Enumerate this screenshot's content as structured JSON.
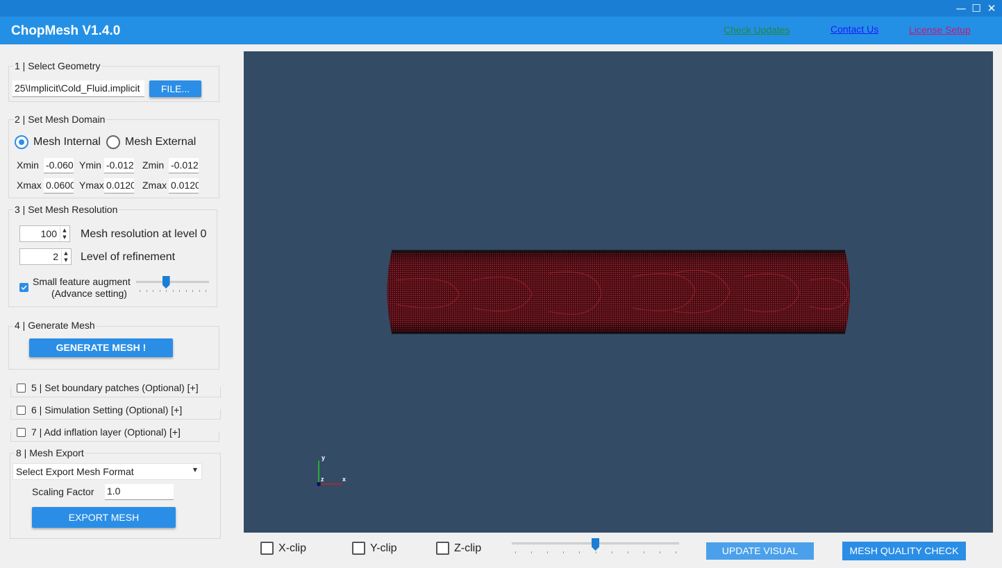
{
  "window": {
    "minimize_glyph": "—",
    "maximize_glyph": "☐",
    "close_glyph": "✕"
  },
  "header": {
    "title": "ChopMesh V1.4.0",
    "links": {
      "check_updates": "Check Updates",
      "contact_us": "Contact Us ",
      "license_setup": "License Setup"
    },
    "link_colors": {
      "check_updates": "#1f8a3a",
      "contact_us": "#1a1aff",
      "license_setup": "#c2187a"
    }
  },
  "geometry": {
    "title": "1 | Select Geometry",
    "file_path": "25\\Implicit\\Cold_Fluid.implicit",
    "file_button": "FILE..."
  },
  "domain": {
    "title": "2 | Set Mesh Domain",
    "mesh_internal": "Mesh Internal",
    "mesh_external": "Mesh External",
    "selected": "internal",
    "xmin_label": "Xmin",
    "xmin": "-0.060",
    "ymin_label": "Ymin",
    "ymin": "-0.012",
    "zmin_label": "Zmin",
    "zmin": "-0.012",
    "xmax_label": "Xmax",
    "xmax": "0.0600",
    "ymax_label": "Ymax",
    "ymax": "0.0120",
    "zmax_label": "Zmax",
    "zmax": "0.0120"
  },
  "resolution": {
    "title": "3 | Set Mesh  Resolution",
    "level0_value": "100",
    "level0_label": "Mesh resolution at level 0",
    "refinement_value": "2",
    "refinement_label": "Level of refinement",
    "small_feature_checked": true,
    "small_feature_line1": "Small feature augment",
    "small_feature_line2": "(Advance setting)",
    "slider_fraction": 0.4
  },
  "generate": {
    "title": "4  | Generate Mesh",
    "button": "GENERATE MESH !"
  },
  "optional": {
    "boundary": "5 | Set boundary patches (Optional) [+]",
    "simulation": "6 | Simulation Setting (Optional) [+]",
    "inflation": "7 | Add inflation layer (Optional) [+]"
  },
  "export": {
    "title": "8 | Mesh Export",
    "format_placeholder": "Select Export Mesh Format",
    "scaling_label": "Scaling Factor",
    "scaling_value": "1.0",
    "button": "EXPORT MESH"
  },
  "viewport": {
    "background": "#344b65",
    "mesh_color": "#7a1620",
    "axis": {
      "x": "x",
      "y": "y",
      "z": "z"
    }
  },
  "bottom": {
    "xclip": "X-clip",
    "yclip": "Y-clip",
    "zclip": "Z-clip",
    "clip_slider_fraction": 0.5,
    "update_visual": "UPDATE VISUAL",
    "mesh_quality": "MESH QUALITY CHECK"
  }
}
